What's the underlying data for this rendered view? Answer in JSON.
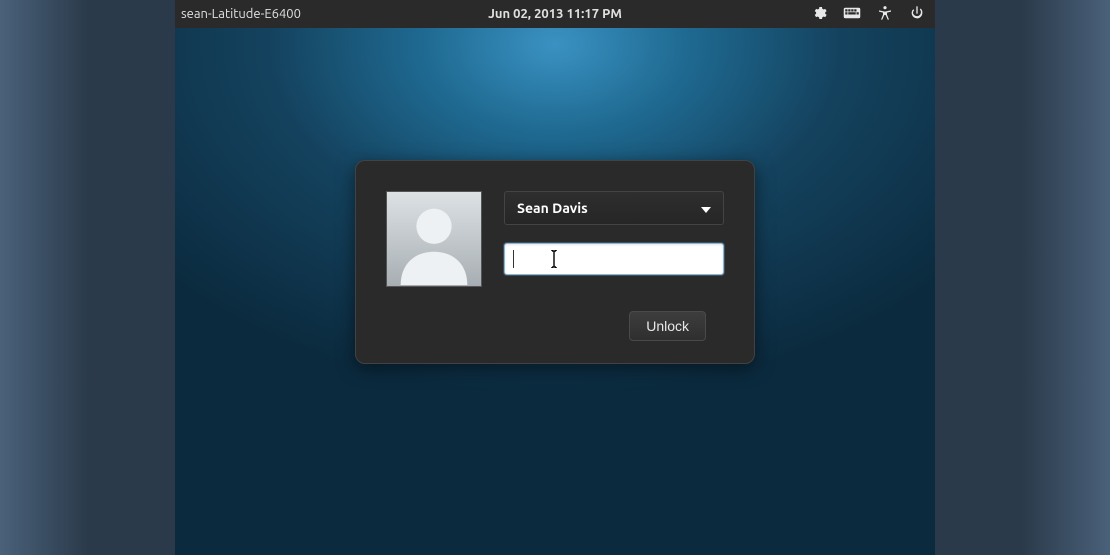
{
  "topbar": {
    "hostname": "sean-Latitude-E6400",
    "datetime": "Jun 02, 2013  11:17 PM"
  },
  "login": {
    "username": "Sean Davis",
    "password_value": "",
    "unlock_label": "Unlock"
  }
}
